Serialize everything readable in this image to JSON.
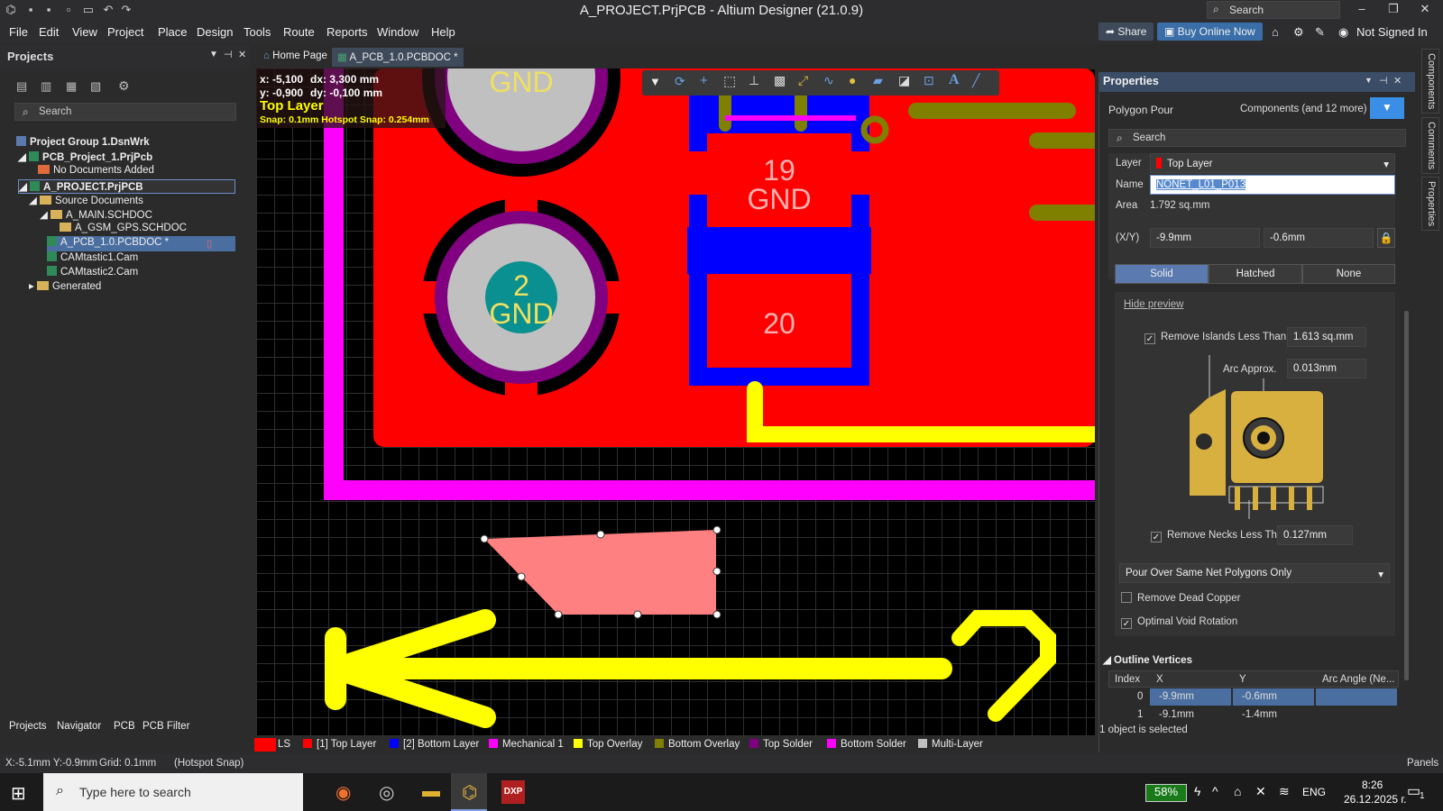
{
  "window": {
    "title": "A_PROJECT.PrjPCB - Altium Designer (21.0.9)",
    "search": "Search"
  },
  "menu": [
    "File",
    "Edit",
    "View",
    "Project",
    "Place",
    "Design",
    "Tools",
    "Route",
    "Reports",
    "Window",
    "Help"
  ],
  "topbar": {
    "share": "Share",
    "buy": "Buy Online Now",
    "user": "Not Signed In"
  },
  "projects": {
    "title": "Projects",
    "search": "Search",
    "tree": [
      "Project Group 1.DsnWrk",
      "PCB_Project_1.PrjPcb",
      "No Documents Added",
      "A_PROJECT.PrjPCB",
      "Source Documents",
      "A_MAIN.SCHDOC",
      "A_GSM_GPS.SCHDOC",
      "A_PCB_1.0.PCBDOC *",
      "CAMtastic1.Cam",
      "CAMtastic2.Cam",
      "Generated"
    ],
    "bottom_tabs": [
      "Projects",
      "Navigator",
      "PCB",
      "PCB Filter"
    ]
  },
  "doc_tabs": [
    "Home Page",
    "A_PCB_1.0.PCBDOC *"
  ],
  "hud": {
    "x": "x: -5,100",
    "dx": "dx:  3,300 mm",
    "y": "y: -0,900",
    "dy": "dy:  -0,100 mm",
    "layer": "Top Layer",
    "snap": "Snap: 0.1mm Hotspot Snap: 0.254mm"
  },
  "pads": {
    "pad_top": "GND",
    "pad2_num": "2",
    "pad2_net": "GND",
    "pad19_num": "19",
    "pad19_net": "GND",
    "pad20_num": "20"
  },
  "layers": {
    "ls": "LS",
    "items": [
      {
        "name": "[1] Top Layer",
        "color": "#ff0000"
      },
      {
        "name": "[2] Bottom Layer",
        "color": "#0000ff"
      },
      {
        "name": "Mechanical 1",
        "color": "#ff00ff"
      },
      {
        "name": "Top Overlay",
        "color": "#ffff00"
      },
      {
        "name": "Bottom Overlay",
        "color": "#808000"
      },
      {
        "name": "Top Solder",
        "color": "#800080"
      },
      {
        "name": "Bottom Solder",
        "color": "#ff00ff"
      },
      {
        "name": "Multi-Layer",
        "color": "#c0c0c0"
      }
    ]
  },
  "properties": {
    "title": "Properties",
    "object": "Polygon Pour",
    "filter": "Components (and 12 more)",
    "search": "Search",
    "layer_label": "Layer",
    "layer_value": "Top Layer",
    "name_label": "Name",
    "name_value": "NONET_L01_P013",
    "area_label": "Area",
    "area_value": "1.792 sq.mm",
    "xy_label": "(X/Y)",
    "x_value": "-9.9mm",
    "y_value": "-0.6mm",
    "fill_modes": [
      "Solid",
      "Hatched",
      "None"
    ],
    "hide_preview": "Hide preview",
    "remove_islands": "Remove Islands Less Than",
    "islands_value": "1.613 sq.mm",
    "arc_approx": "Arc Approx.",
    "arc_value": "0.013mm",
    "remove_necks": "Remove Necks Less Than",
    "necks_value": "0.127mm",
    "pour_over": "Pour Over Same Net Polygons Only",
    "remove_dead": "Remove Dead Copper",
    "optimal_void": "Optimal Void Rotation",
    "outline_vertices": "Outline Vertices",
    "vertex_headers": [
      "Index",
      "X",
      "Y",
      "Arc Angle (Ne..."
    ],
    "vertices": [
      {
        "index": "0",
        "x": "-9.9mm",
        "y": "-0.6mm"
      },
      {
        "index": "1",
        "x": "-9.1mm",
        "y": "-1.4mm"
      }
    ],
    "selected": "1 object is selected"
  },
  "side_tabs": [
    "Components",
    "Comments",
    "Properties"
  ],
  "status": {
    "coords": "X:-5.1mm Y:-0.9mm",
    "grid": "Grid: 0.1mm",
    "snap": "(Hotspot Snap)",
    "panels": "Panels"
  },
  "taskbar": {
    "search": "Type here to search",
    "battery": "58%",
    "lang": "ENG",
    "time": "8:26",
    "date": "26.12.2025 г.",
    "notif": "1"
  },
  "colors": {
    "copper_top": "#ff0000",
    "copper_bottom": "#0000ff",
    "overlay": "#ffff00",
    "mech": "#ff00ff",
    "polygon": "#ff8080",
    "accent": "#3a8ee6"
  }
}
